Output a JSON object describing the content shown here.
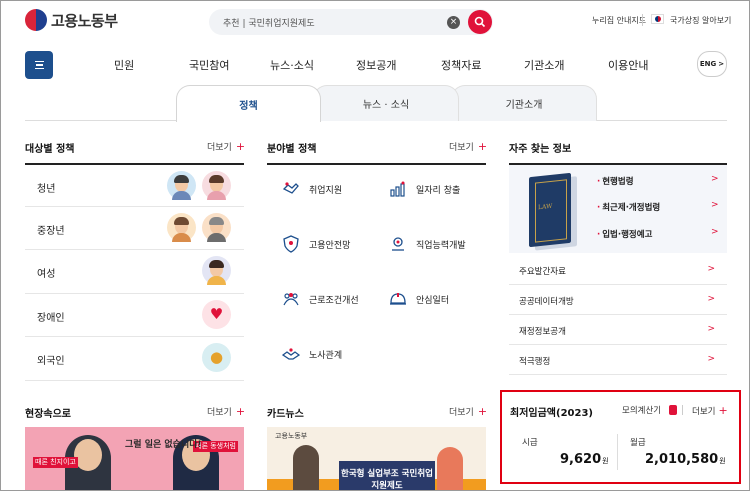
{
  "header": {
    "logo_text": "고용노동부",
    "search": {
      "category": "추천",
      "separator": "|",
      "value": "국민취업지원제도"
    },
    "util_links": {
      "sitemap": "누리집 안내지도",
      "national_symbol": "국가상징 알아보기"
    }
  },
  "gnb": {
    "items": [
      "민원",
      "국민참여",
      "뉴스·소식",
      "정보공개",
      "정책자료",
      "기관소개",
      "이용안내"
    ],
    "eng_label": "ENG",
    "eng_chevron": ">"
  },
  "tabs": [
    "정책",
    "뉴스 · 소식",
    "기관소개"
  ],
  "target_policy": {
    "title": "대상별 정책",
    "more": "더보기",
    "items": [
      "청년",
      "중장년",
      "여성",
      "장애인",
      "외국인"
    ]
  },
  "field_policy": {
    "title": "분야별 정책",
    "more": "더보기",
    "items": [
      "취업지원",
      "일자리 창출",
      "고용안전망",
      "직업능력개발",
      "근로조건개선",
      "안심일터",
      "노사관계"
    ]
  },
  "frequent_info": {
    "title": "자주 찾는 정보",
    "book_text": "LAW",
    "law_links": [
      "현행법령",
      "최근제·개정법령",
      "입법·행정예고"
    ],
    "rows": [
      "주요발간자료",
      "공공데이터개방",
      "재정정보공개",
      "적극행정"
    ],
    "chevron": ">"
  },
  "minimum_wage": {
    "title": "최저임금액(2023)",
    "calc": "모의계산기",
    "more": "더보기",
    "hourly_label": "시급",
    "hourly_value": "9,620",
    "monthly_label": "월급",
    "monthly_value": "2,010,580",
    "unit": "원"
  },
  "field_section": {
    "title": "현장속으로",
    "more": "더보기",
    "tag1": "때론 친지이고",
    "tag2": "때론 동생처럼",
    "bubble": "그럴 일은 없습니다!"
  },
  "card_news": {
    "title": "카드뉴스",
    "more": "더보기",
    "logo": "고용노동부",
    "headline": "한국형 실업부조 국민취업지원제도"
  },
  "more_plus": "+",
  "colors": {
    "brand_blue": "#1d4f8d",
    "accent_red": "#e0123a",
    "highlight_border": "#e00012"
  }
}
